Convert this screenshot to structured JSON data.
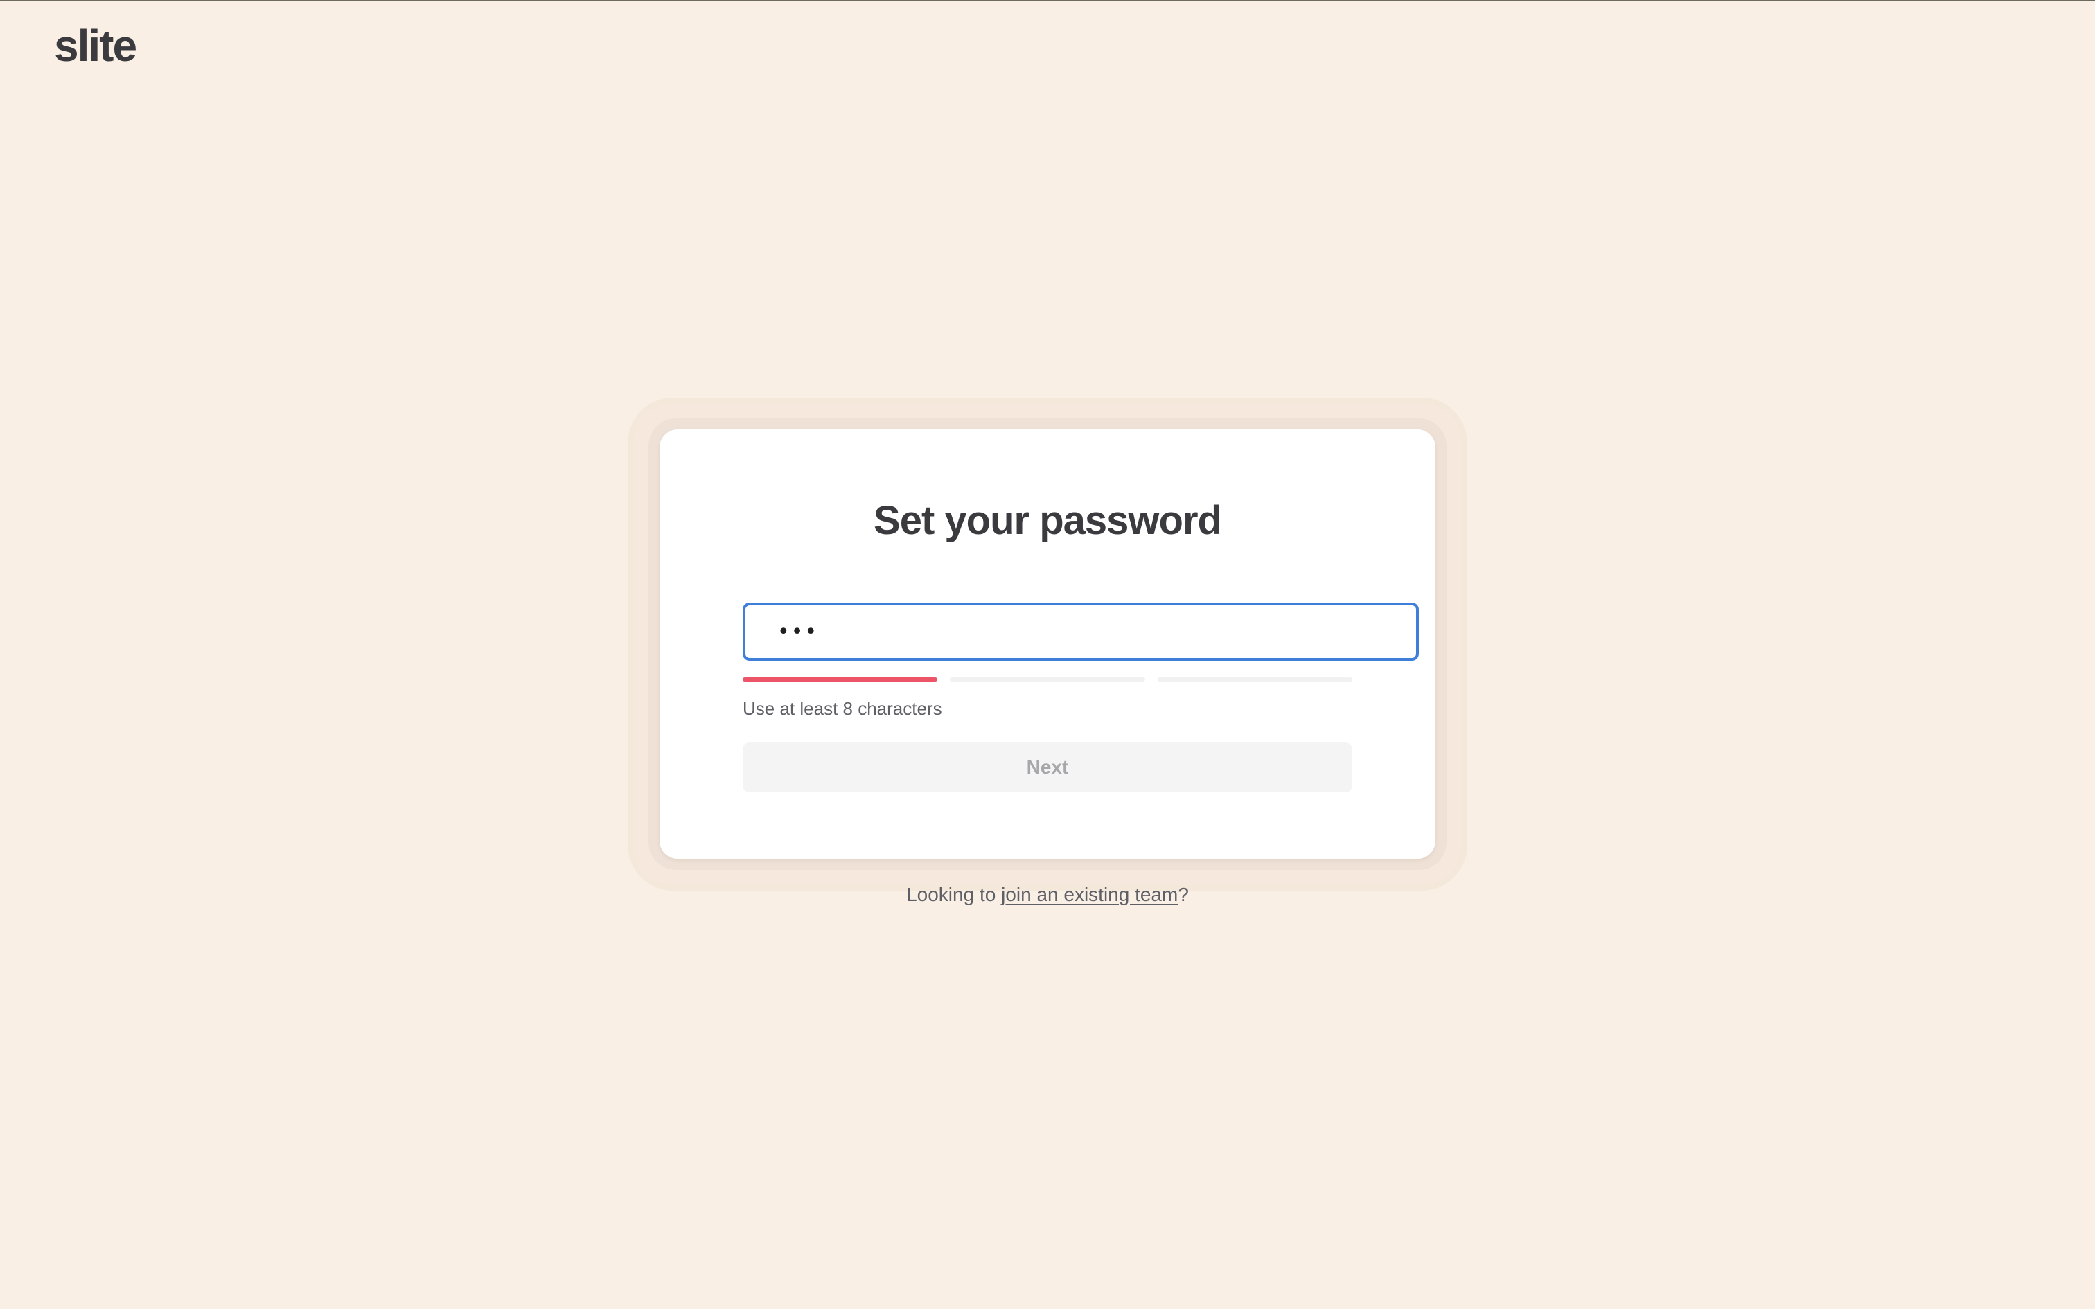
{
  "app": {
    "logo_text": "slite"
  },
  "card": {
    "title": "Set your password",
    "password_input": {
      "value": "•••",
      "placeholder": ""
    },
    "strength": {
      "segments": 3,
      "filled": 1,
      "active_color": "#ec5468"
    },
    "hint": "Use at least 8 characters",
    "next_label": "Next"
  },
  "footer": {
    "prefix": "Looking to ",
    "link_label": "join an existing team",
    "suffix": "?"
  },
  "colors": {
    "background": "#f9efe5",
    "focus_border": "#3f7fd9"
  }
}
